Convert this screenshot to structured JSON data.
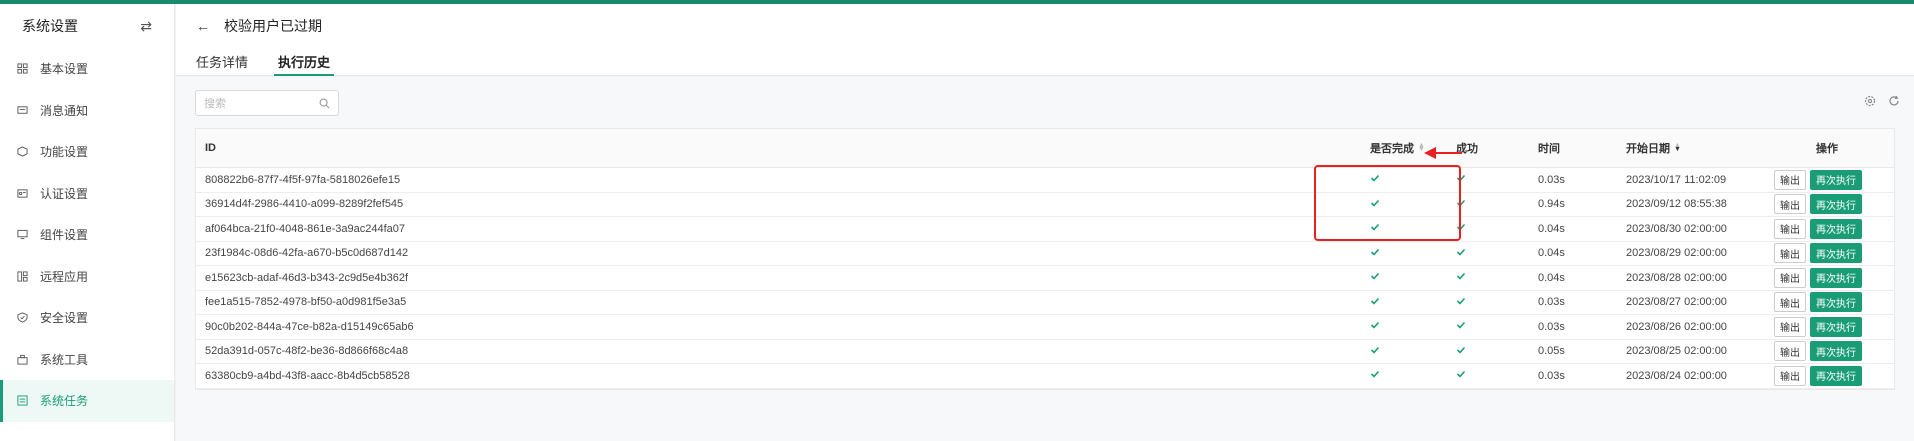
{
  "sidebar": {
    "title": "系统设置",
    "items": [
      {
        "label": "基本设置",
        "icon": "grid-icon"
      },
      {
        "label": "消息通知",
        "icon": "message-icon"
      },
      {
        "label": "功能设置",
        "icon": "cube-icon"
      },
      {
        "label": "认证设置",
        "icon": "id-card-icon"
      },
      {
        "label": "组件设置",
        "icon": "monitor-icon"
      },
      {
        "label": "远程应用",
        "icon": "apps-icon"
      },
      {
        "label": "安全设置",
        "icon": "shield-icon"
      },
      {
        "label": "系统工具",
        "icon": "toolbox-icon"
      },
      {
        "label": "系统任务",
        "icon": "task-icon",
        "active": true
      }
    ]
  },
  "header": {
    "title": "校验用户已过期",
    "tabs": [
      {
        "label": "任务详情"
      },
      {
        "label": "执行历史",
        "active": true
      }
    ]
  },
  "search": {
    "placeholder": "搜索"
  },
  "table": {
    "columns": {
      "id": "ID",
      "done": "是否完成",
      "success": "成功",
      "time": "时间",
      "start": "开始日期",
      "ops": "操作"
    },
    "actions": {
      "output": "输出",
      "rerun": "再次执行"
    },
    "rows": [
      {
        "id": "808822b6-87f7-4f5f-97fa-5818026efe15",
        "time": "0.03s",
        "start": "2023/10/17 11:02:09"
      },
      {
        "id": "36914d4f-2986-4410-a099-8289f2fef545",
        "time": "0.94s",
        "start": "2023/09/12 08:55:38"
      },
      {
        "id": "af064bca-21f0-4048-861e-3a9ac244fa07",
        "time": "0.04s",
        "start": "2023/08/30 02:00:00"
      },
      {
        "id": "23f1984c-08d6-42fa-a670-b5c0d687d142",
        "time": "0.04s",
        "start": "2023/08/29 02:00:00"
      },
      {
        "id": "e15623cb-adaf-46d3-b343-2c9d5e4b362f",
        "time": "0.04s",
        "start": "2023/08/28 02:00:00"
      },
      {
        "id": "fee1a515-7852-4978-bf50-a0d981f5e3a5",
        "time": "0.03s",
        "start": "2023/08/27 02:00:00"
      },
      {
        "id": "90c0b202-844a-47ce-b82a-d15149c65ab6",
        "time": "0.03s",
        "start": "2023/08/26 02:00:00"
      },
      {
        "id": "52da391d-057c-48f2-be36-8d866f68c4a8",
        "time": "0.05s",
        "start": "2023/08/25 02:00:00"
      },
      {
        "id": "63380cb9-a4bd-43f8-aacc-8b4d5cb58528",
        "time": "0.03s",
        "start": "2023/08/24 02:00:00"
      }
    ]
  },
  "colors": {
    "accent": "#1a9d77",
    "annotation": "#e82020"
  }
}
